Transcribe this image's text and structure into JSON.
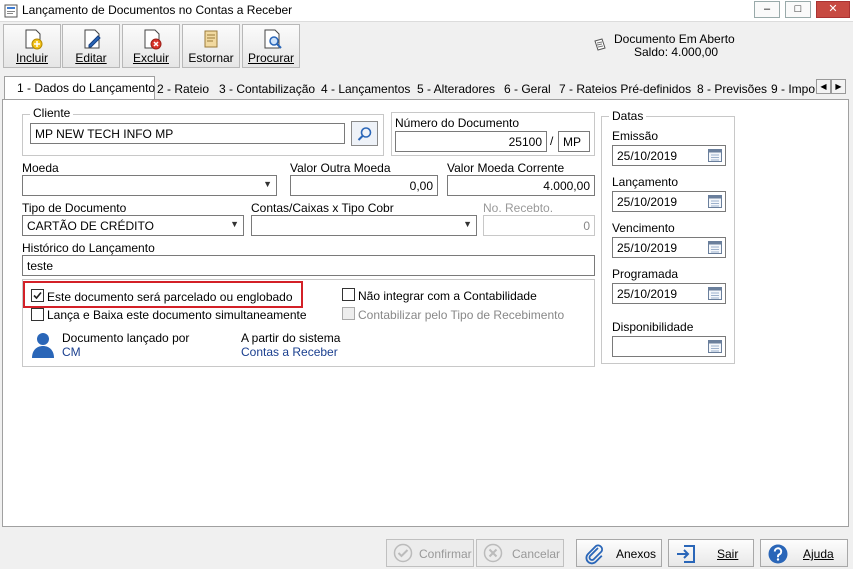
{
  "window": {
    "title": "Lançamento de Documentos no Contas a Receber",
    "minimize": "–",
    "maximize": "□",
    "close": "✕"
  },
  "toolbar": {
    "incluir": "Incluir",
    "editar": "Editar",
    "excluir": "Excluir",
    "estornar": "Estornar",
    "procurar": "Procurar"
  },
  "status": {
    "line1": "Documento Em Aberto",
    "line2": "Saldo: 4.000,00"
  },
  "tabs": [
    "1 - Dados do Lançamento",
    "2 - Rateio",
    "3 - Contabilização",
    "4 - Lançamentos",
    "5 - Alteradores",
    "6 - Geral",
    "7 - Rateios Pré-definidos",
    "8 - Previsões",
    "9 - Impo"
  ],
  "form": {
    "cliente_label": "Cliente",
    "cliente_value": "MP NEW TECH INFO MP",
    "numero_label": "Número do Documento",
    "numero_value": "25100",
    "numero_sep": "/",
    "numero_suffix": "MP",
    "moeda_label": "Moeda",
    "moeda_value": "",
    "valor_outra_label": "Valor Outra Moeda",
    "valor_outra_value": "0,00",
    "valor_corrente_label": "Valor Moeda Corrente",
    "valor_corrente_value": "4.000,00",
    "tipo_doc_label": "Tipo de Documento",
    "tipo_doc_value": "CARTÃO DE CRÉDITO",
    "contas_label": "Contas/Caixas x Tipo Cobr",
    "contas_value": "",
    "recebto_label": "No. Recebto.",
    "recebto_value": "0",
    "historico_label": "Histórico do Lançamento",
    "historico_value": "teste",
    "chk_parcelado": "Este documento será parcelado ou englobado",
    "chk_lanca_baixa": "Lança e Baixa este documento simultaneamente",
    "chk_nao_integrar": "Não integrar com a Contabilidade",
    "chk_contabilizar": "Contabilizar pelo Tipo de Recebimento",
    "lancado_por_label": "Documento lançado por",
    "lancado_por_value": "CM",
    "sistema_label": "A partir do sistema",
    "sistema_value": "Contas a Receber"
  },
  "datas": {
    "title": "Datas",
    "emissao_label": "Emissão",
    "emissao_value": "25/10/2019",
    "lancamento_label": "Lançamento",
    "lancamento_value": "25/10/2019",
    "vencimento_label": "Vencimento",
    "vencimento_value": "25/10/2019",
    "programada_label": "Programada",
    "programada_value": "25/10/2019",
    "disponibilidade_label": "Disponibilidade",
    "disponibilidade_value": ""
  },
  "buttons": {
    "confirmar": "Confirmar",
    "cancelar": "Cancelar",
    "anexos": "Anexos",
    "sair": "Sair",
    "ajuda": "Ajuda"
  },
  "checkbox_state": {
    "parcelado": true,
    "lanca_baixa": false,
    "nao_integrar": false,
    "contabilizar": false
  },
  "colors": {
    "highlight": "#d32027",
    "link_blue": "#1a3f8f",
    "icon_blue": "#2a66b8"
  }
}
